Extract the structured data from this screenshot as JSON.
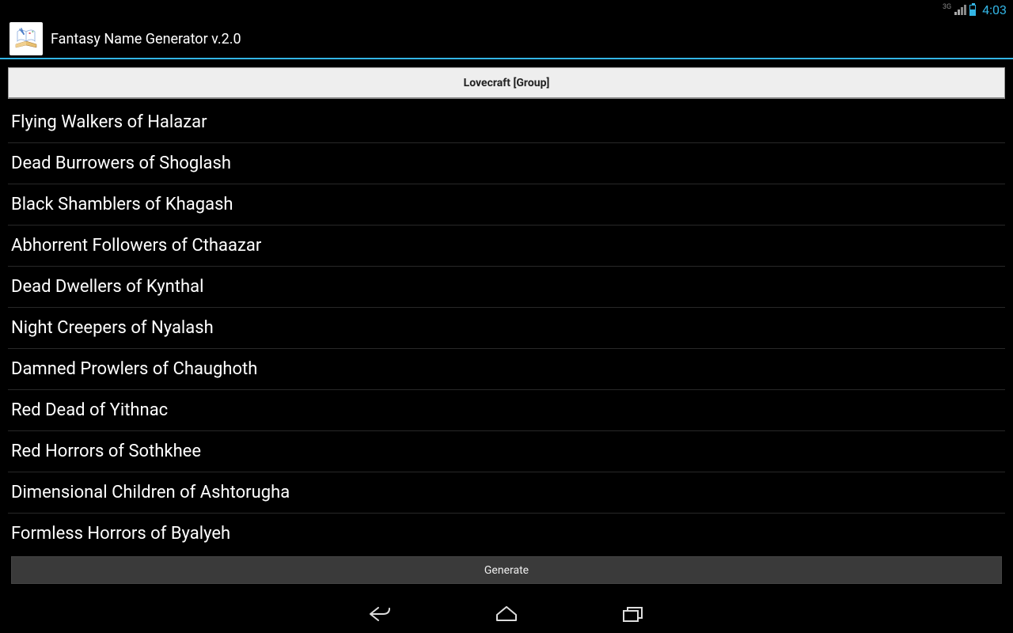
{
  "status": {
    "network": "3G",
    "clock": "4:03"
  },
  "app": {
    "title": "Fantasy Name Generator v.2.0"
  },
  "spinner": {
    "selected": "Lovecraft [Group]"
  },
  "names": [
    "Flying Walkers of Halazar",
    "Dead Burrowers of Shoglash",
    "Black Shamblers of Khagash",
    "Abhorrent Followers of Cthaazar",
    "Dead Dwellers of Kynthal",
    "Night Creepers of Nyalash",
    "Damned Prowlers of Chaughoth",
    "Red Dead of Yithnac",
    "Red Horrors of Sothkhee",
    "Dimensional Children of Ashtorugha",
    "Formless Horrors of Byalyeh"
  ],
  "buttons": {
    "generate": "Generate"
  }
}
